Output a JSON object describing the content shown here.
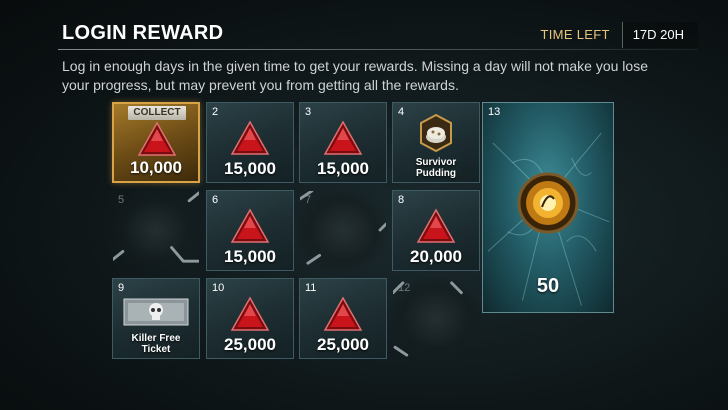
{
  "header": {
    "title": "LOGIN REWARD",
    "time_left_label": "TIME LEFT",
    "time_left_value": "17D 20H"
  },
  "description": "Log in enough days in the given time to get your rewards. Missing a day will not make you lose your progress, but may prevent you from getting all the rewards.",
  "rewards": {
    "d1": {
      "day": "1",
      "amount": "10,000",
      "state": "collect",
      "collect_label": "COLLECT",
      "icon": "iridescent-shard-icon"
    },
    "d2": {
      "day": "2",
      "amount": "15,000",
      "icon": "iridescent-shard-icon"
    },
    "d3": {
      "day": "3",
      "amount": "15,000",
      "icon": "iridescent-shard-icon"
    },
    "d4": {
      "day": "4",
      "item": "Survivor Pudding",
      "icon": "survivor-pudding-icon"
    },
    "d5": {
      "day": "5",
      "state": "locked",
      "icon": "chain-icon"
    },
    "d6": {
      "day": "6",
      "amount": "15,000",
      "icon": "iridescent-shard-icon"
    },
    "d7": {
      "day": "7",
      "state": "locked",
      "icon": "chain-icon"
    },
    "d8": {
      "day": "8",
      "amount": "20,000",
      "icon": "iridescent-shard-icon"
    },
    "d9": {
      "day": "9",
      "item": "Killer Free Ticket",
      "icon": "killer-ticket-icon"
    },
    "d10": {
      "day": "10",
      "amount": "25,000",
      "icon": "iridescent-shard-icon"
    },
    "d11": {
      "day": "11",
      "amount": "25,000",
      "icon": "iridescent-shard-icon"
    },
    "d12": {
      "day": "12",
      "state": "locked",
      "icon": "chain-icon"
    },
    "d13": {
      "day": "13",
      "amount": "50",
      "icon": "auric-cells-icon"
    }
  },
  "colors": {
    "accent_gold": "#e6c47a",
    "tile_border": "#3e5a62",
    "shard_red": "#c8141a"
  }
}
